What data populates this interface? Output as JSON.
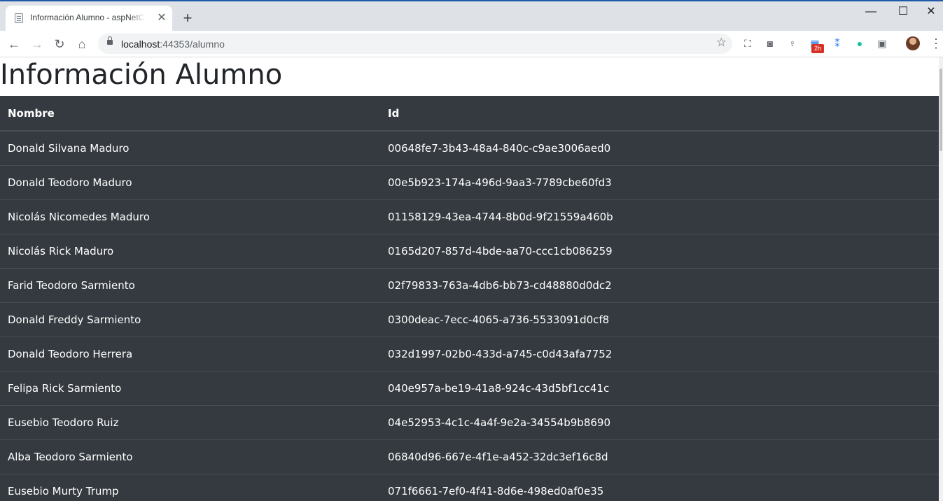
{
  "browser": {
    "tab_title": "Información Alumno - aspNetCore",
    "close_glyph": "✕",
    "new_tab_glyph": "+",
    "url_host": "localhost",
    "url_rest": ":44353/alumno",
    "extension_badge": "2h",
    "window_controls": [
      "—",
      "☐",
      "✕"
    ]
  },
  "page": {
    "heading": "Información Alumno",
    "table": {
      "headers": [
        "Nombre",
        "Id"
      ],
      "rows": [
        [
          "Donald Silvana Maduro",
          "00648fe7-3b43-48a4-840c-c9ae3006aed0"
        ],
        [
          "Donald Teodoro Maduro",
          "00e5b923-174a-496d-9aa3-7789cbe60fd3"
        ],
        [
          "Nicolás Nicomedes Maduro",
          "01158129-43ea-4744-8b0d-9f21559a460b"
        ],
        [
          "Nicolás Rick Maduro",
          "0165d207-857d-4bde-aa70-ccc1cb086259"
        ],
        [
          "Farid Teodoro Sarmiento",
          "02f79833-763a-4db6-bb73-cd48880d0dc2"
        ],
        [
          "Donald Freddy Sarmiento",
          "0300deac-7ecc-4065-a736-5533091d0cf8"
        ],
        [
          "Donald Teodoro Herrera",
          "032d1997-02b0-433d-a745-c0d43afa7752"
        ],
        [
          "Felipa Rick Sarmiento",
          "040e957a-be19-41a8-924c-43d5bf1cc41c"
        ],
        [
          "Eusebio Teodoro Ruiz",
          "04e52953-4c1c-4a4f-9e2a-34554b9b8690"
        ],
        [
          "Alba Teodoro Sarmiento",
          "06840d96-667e-4f1e-a452-32dc3ef16c8d"
        ],
        [
          "Eusebio Murty Trump",
          "071f6661-7ef0-4f41-8d6e-498ed0af0e35"
        ]
      ]
    }
  },
  "colors": {
    "table_bg": "#343a40",
    "table_border": "#454d55",
    "tabstrip_bg": "#dee1e6"
  }
}
